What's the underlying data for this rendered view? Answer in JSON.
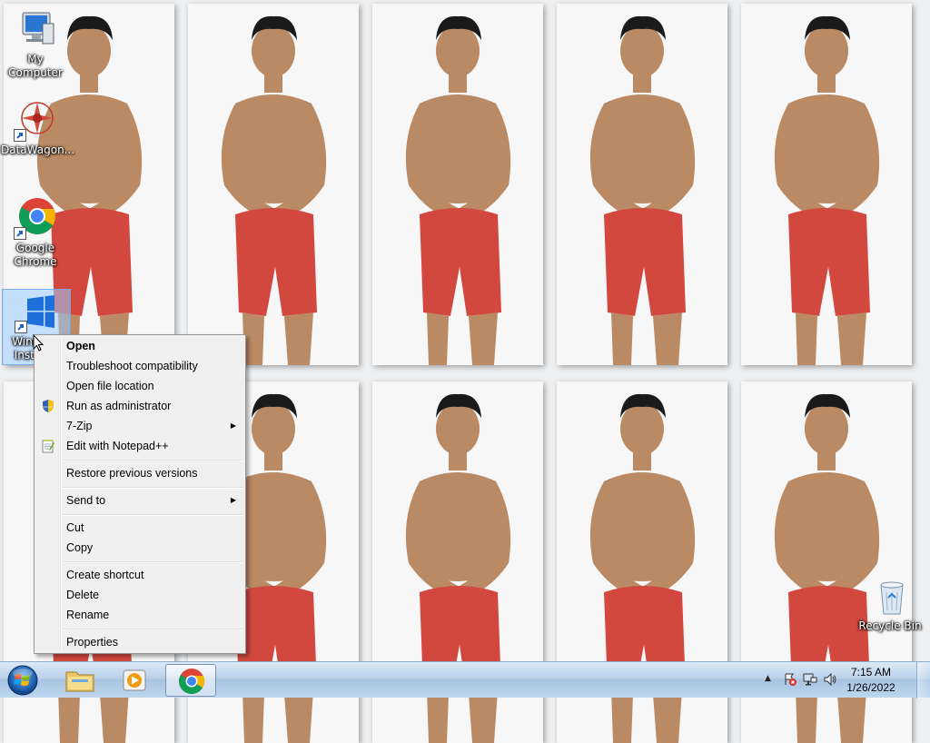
{
  "desktop": {
    "icons": [
      {
        "label": "My Computer"
      },
      {
        "label": "DataWagon..."
      },
      {
        "label": "Google Chrome"
      },
      {
        "label": "Windows Installer"
      },
      {
        "label": "Recycle Bin"
      }
    ]
  },
  "context_menu": {
    "items": [
      {
        "label": "Open"
      },
      {
        "label": "Troubleshoot compatibility"
      },
      {
        "label": "Open file location"
      },
      {
        "label": "Run as administrator"
      },
      {
        "label": "7-Zip"
      },
      {
        "label": "Edit with Notepad++"
      },
      {
        "label": "Restore previous versions"
      },
      {
        "label": "Send to"
      },
      {
        "label": "Cut"
      },
      {
        "label": "Copy"
      },
      {
        "label": "Create shortcut"
      },
      {
        "label": "Delete"
      },
      {
        "label": "Rename"
      },
      {
        "label": "Properties"
      }
    ]
  },
  "taskbar": {
    "clock": {
      "time": "7:15 AM",
      "date": "1/26/2022"
    }
  },
  "colors": {
    "accent": "#1e6fd9",
    "taskbar": "#b9d1ea",
    "shorts": "#d2483f",
    "skin": "#b98a63"
  }
}
